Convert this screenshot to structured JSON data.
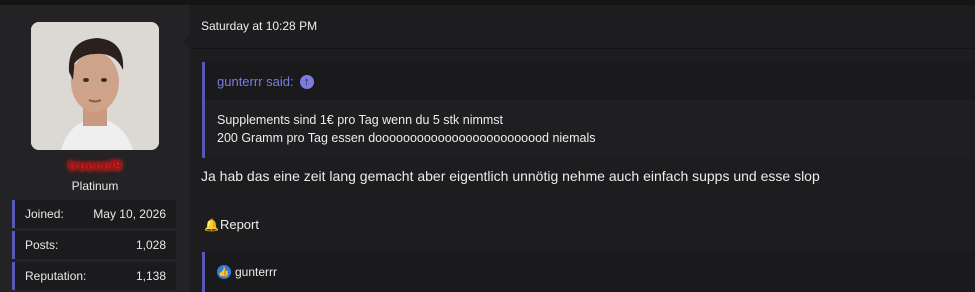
{
  "user": {
    "name": "truecel9",
    "title": "Platinum",
    "stats": [
      {
        "label": "Joined:",
        "value": "May 10, 2026"
      },
      {
        "label": "Posts:",
        "value": "1,028"
      },
      {
        "label": "Reputation:",
        "value": "1,138"
      }
    ]
  },
  "post": {
    "date": "Saturday at 10:28 PM",
    "quote": {
      "author_line": "gunterrr said:",
      "lines": [
        "Supplements sind 1€ pro Tag wenn du 5 stk nimmst",
        "200 Gramm pro Tag essen dooooooooooooooooooooooood niemals"
      ]
    },
    "message": "Ja hab das eine zeit lang gemacht aber eigentlich unnötig nehme auch einfach supps und esse slop",
    "report_label": "Report",
    "likes_by": "gunterrr"
  },
  "colors": {
    "accent": "#5757b8",
    "quote_author": "#7c7ce0",
    "username_glow": "#ff2b2b",
    "like_blue": "#2c7be5"
  },
  "icons": {
    "quote_jump": "arrow-up-circle-icon",
    "report": "bell-icon",
    "like": "thumbs-up-icon"
  }
}
